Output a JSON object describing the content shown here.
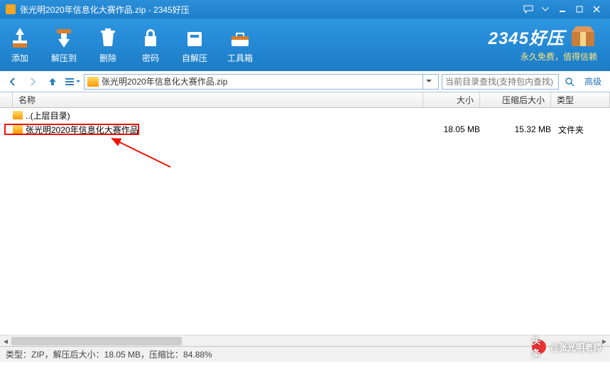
{
  "titlebar": {
    "title": "张光明2020年信息化大赛作品.zip - 2345好压"
  },
  "toolbar": {
    "add": "添加",
    "extract": "解压到",
    "delete": "删除",
    "password": "密码",
    "sfx": "自解压",
    "tools": "工具箱"
  },
  "brand": {
    "name": "2345好压",
    "slogan": "永久免费，值得信赖"
  },
  "nav": {
    "path": "张光明2020年信息化大赛作品.zip",
    "search_placeholder": "当前目录查找(支持包内查找)",
    "advanced": "高级"
  },
  "columns": {
    "sort": " ",
    "name": "名称",
    "size": "大小",
    "packed": "压缩后大小",
    "type": "类型"
  },
  "rows": [
    {
      "name": "..(上层目录)",
      "size": "",
      "packed": "",
      "type": ""
    },
    {
      "name": "张光明2020年信息化大赛作品",
      "size": "18.05 MB",
      "packed": "15.32 MB",
      "type": "文件夹"
    }
  ],
  "status": "类型：ZIP，解压后大小：18.05 MB，压缩比：84.88%",
  "watermark": {
    "prefix": "头条",
    "author": "@张光明老师"
  }
}
